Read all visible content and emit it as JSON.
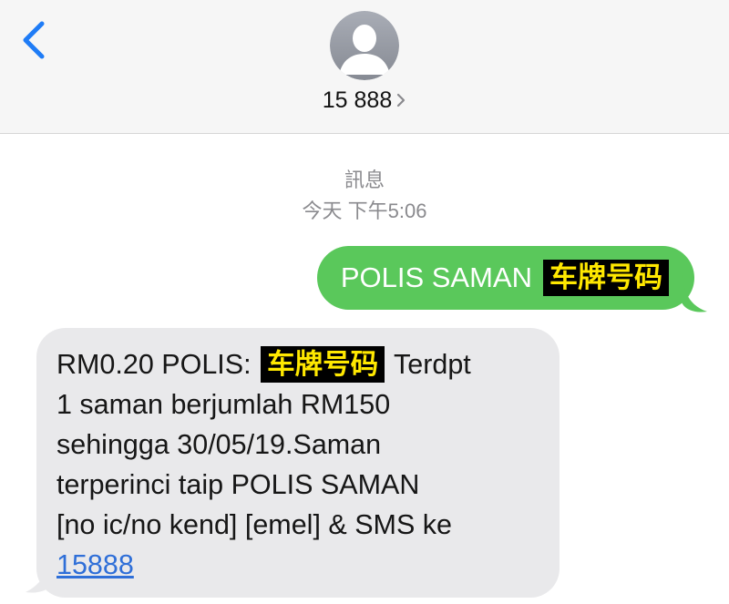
{
  "header": {
    "back_icon": "chevron-left-icon",
    "avatar_icon": "person-silhouette-icon",
    "contact_name": "15 888",
    "contact_chevron_icon": "chevron-right-icon"
  },
  "conversation": {
    "service_label": "訊息",
    "date_label": "今天",
    "time_label": "下午5:06"
  },
  "messages": {
    "outgoing": {
      "text": "POLIS SAMAN",
      "redacted_text": "车牌号码"
    },
    "incoming": {
      "line1_prefix": "RM0.20 POLIS:",
      "redacted_text": "车牌号码",
      "line1_suffix": "Terdpt",
      "line2": "1 saman berjumlah RM150",
      "line3": "sehingga 30/05/19.Saman",
      "line4": "terperinci taip POLIS SAMAN",
      "line5": "[no ic/no kend] [emel] & SMS ke",
      "link": "15888"
    }
  },
  "colors": {
    "outgoing_bubble": "#5ac85b",
    "incoming_bubble": "#e9e9eb",
    "link": "#2f6fd8",
    "redaction_bg": "#000000",
    "redaction_text": "#ffe800",
    "ios_blue": "#1f7cf6"
  }
}
